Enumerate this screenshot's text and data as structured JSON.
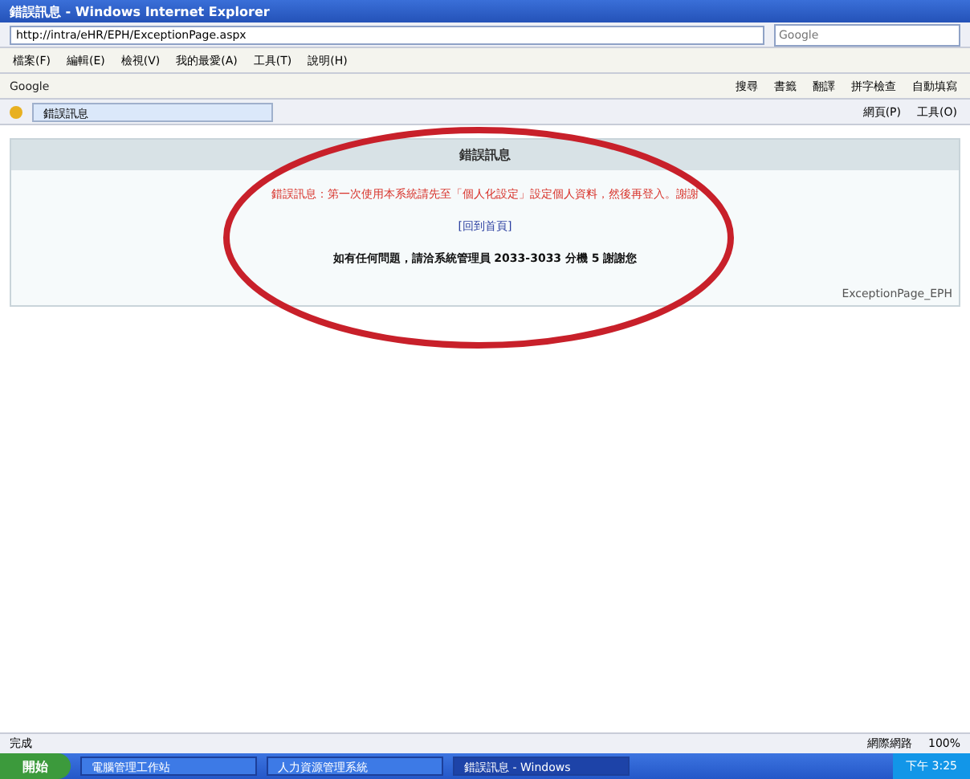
{
  "window": {
    "title": "錯誤訊息 - Windows Internet Explorer"
  },
  "address": {
    "value": "http://intra/eHR/EPH/ExceptionPage.aspx"
  },
  "search": {
    "placeholder": "Google"
  },
  "menu": [
    "檔案(F)",
    "編輯(E)",
    "檢視(V)",
    "我的最愛(A)",
    "工具(T)",
    "說明(H)"
  ],
  "google_toolbar": {
    "label": "Google",
    "buttons": [
      "搜尋",
      "書籤",
      "翻譯",
      "拼字檢查",
      "自動填寫"
    ]
  },
  "tab": {
    "title": "錯誤訊息",
    "selected": true
  },
  "command_bar": [
    "網頁(P)",
    "工具(O)"
  ],
  "panel": {
    "heading": "錯誤訊息",
    "error": "錯誤訊息：第一次使用本系統請先至「個人化設定」設定個人資料，然後再登入。謝謝",
    "link": "[回到首頁]",
    "contact": "如有任何問題，請洽系統管理員 2033-3033 分機 5 謝謝您",
    "page_id": "ExceptionPage_EPH"
  },
  "annotation": {
    "kind": "ellipse",
    "color": "#c8202a"
  },
  "status": {
    "text": "完成",
    "zone": "網際網路",
    "zoom": "100%"
  },
  "taskbar": {
    "start": "開始",
    "items": [
      {
        "label": "電腦管理工作站",
        "selected": false
      },
      {
        "label": "人力資源管理系統",
        "selected": false
      },
      {
        "label": "錯誤訊息 - Windows",
        "selected": true
      }
    ],
    "clock": "下午 3:25"
  }
}
